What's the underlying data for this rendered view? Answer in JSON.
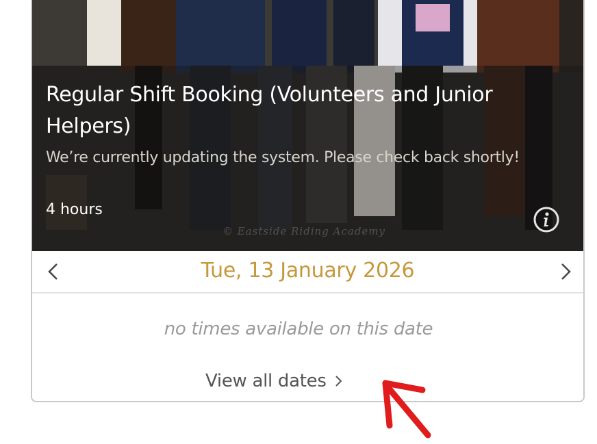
{
  "card": {
    "title": "Regular Shift Booking (Volunteers and Junior Helpers)",
    "subtitle": "We’re currently updating the system. Please check back shortly!",
    "duration": "4 hours",
    "watermark": "© Eastside Riding Academy",
    "info_icon": "info-icon"
  },
  "date_nav": {
    "prev_icon": "chevron-left-icon",
    "date": "Tue, 13 January 2026",
    "next_icon": "chevron-right-icon"
  },
  "availability": {
    "message": "no times available on this date",
    "view_all_label": "View all dates",
    "view_all_icon": "chevron-right-icon"
  },
  "colors": {
    "date_accent": "#c6983d",
    "annotation_arrow": "#e01c1c"
  }
}
